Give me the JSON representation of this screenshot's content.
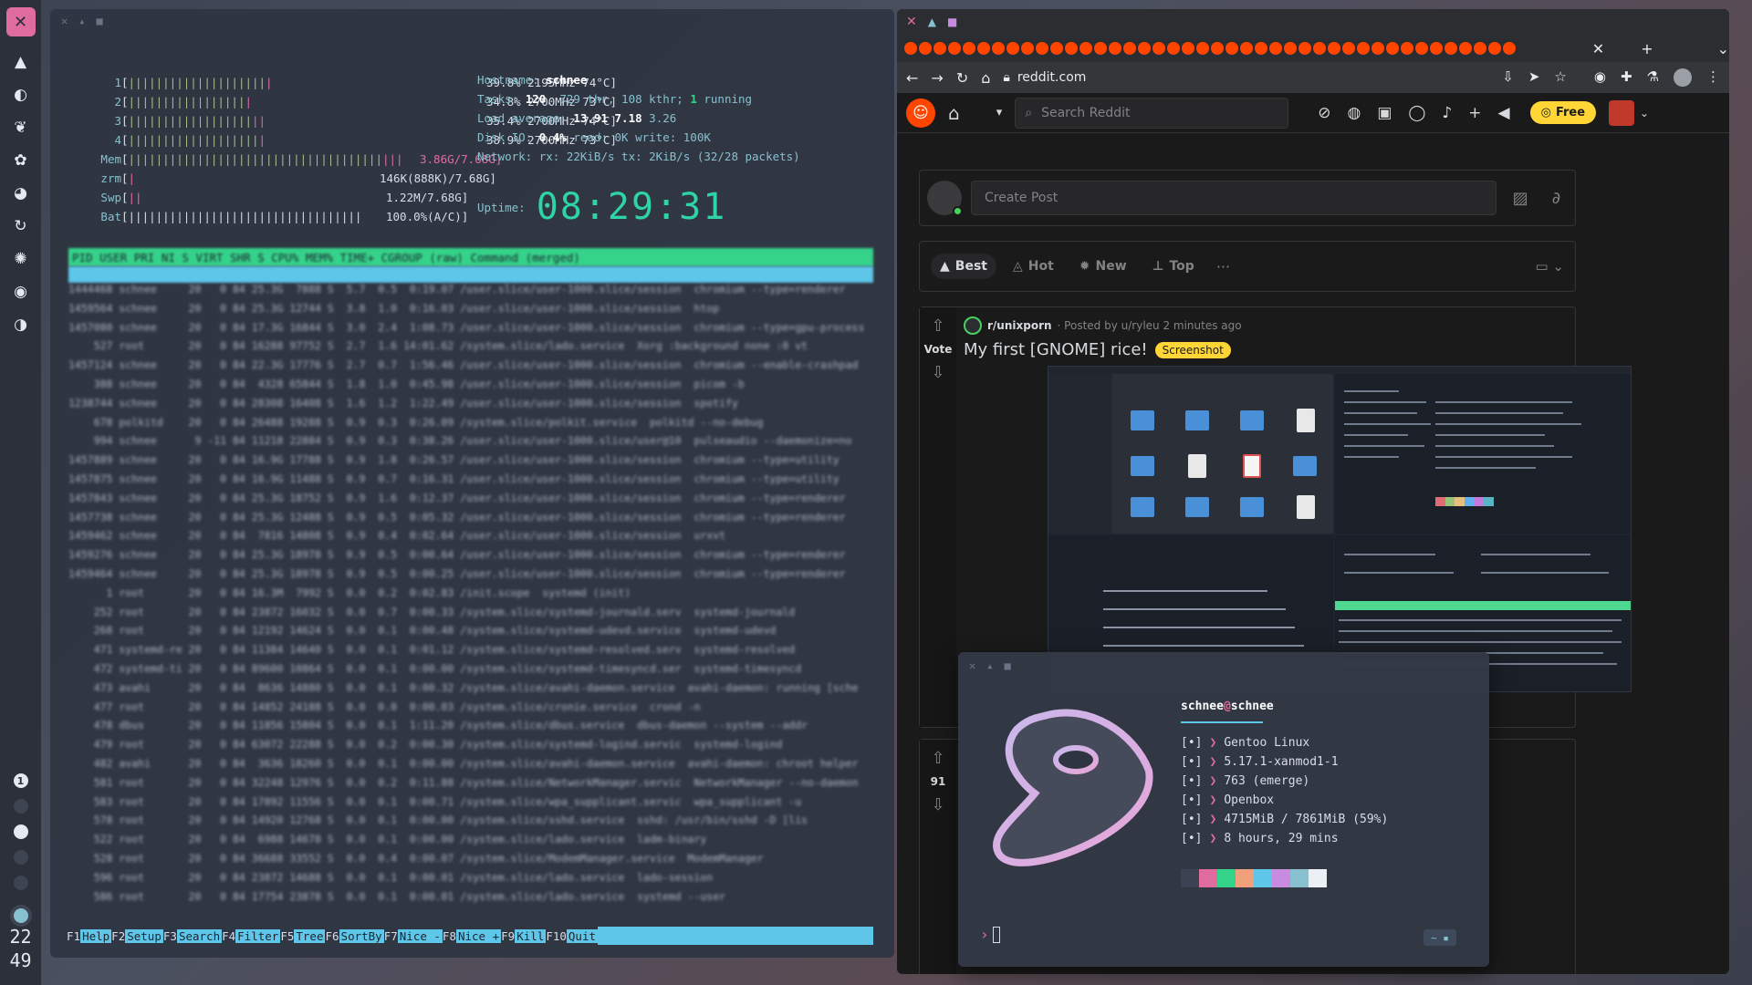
{
  "dock": {
    "icons": [
      "mountain-icon",
      "moon-icon",
      "leaf-icon",
      "lotus-icon",
      "palette-icon",
      "refresh-icon",
      "aperture-icon",
      "disc-icon",
      "audio-icon"
    ],
    "workspaces": [
      "1"
    ],
    "clock_hour": "22",
    "clock_min": "49"
  },
  "htop": {
    "cpus": [
      {
        "label": "1",
        "value": "39.8% 2195MHz 74°C]"
      },
      {
        "label": "2",
        "value": "34.8% 2700MHz 73°C]"
      },
      {
        "label": "3",
        "value": "35.4% 2700MHz 74°C]"
      },
      {
        "label": "4",
        "value": "38.9% 2700MHz 73°C]"
      }
    ],
    "mem": {
      "label": "Mem",
      "value": "3.86G/7.68G]"
    },
    "zrm": {
      "label": "zrm",
      "value": "146K(888K)/7.68G]"
    },
    "swp": {
      "label": "Swp",
      "value": "1.22M/7.68G]"
    },
    "bat": {
      "label": "Bat",
      "value": "100.0%(A/C)]"
    },
    "hostname_label": "Hostname: ",
    "hostname": "schnee",
    "tasks_label": "Tasks: ",
    "tasks": "120",
    "tasks_rest": ", 729 thr, 108 kthr; ",
    "running": "1",
    "running_label": " running",
    "load_label": "Load average: ",
    "load1": "13.91",
    "load5": "7.18",
    "load15": "3.26",
    "disk_label": "Disk IO: ",
    "disk_pct": "0.4%",
    "disk_rest": " read: 0K write: 100K",
    "net": "Network: rx: 22KiB/s tx: 2KiB/s (32/28 packets)",
    "uptime_label": "Uptime:",
    "uptime": "08:29:31",
    "header": "PID USER      PRI  NI S  VIRT  SHR S CPU% MEM%  TIME+  CGROUP (raw)                    Command (merged)",
    "rows": [
      "1444468 schnee     20   0 84 25.3G  7888 S  5.7  0.5  0:19.07 /user.slice/user-1000.slice/session  chromium --type=renderer",
      "1459564 schnee     20   0 84 25.3G 12744 S  3.8  1.0  0:16.03 /user.slice/user-1000.slice/session  htop",
      "1457080 schnee     20   0 84 17.3G 16844 S  3.0  2.4  1:08.73 /user.slice/user-1000.slice/session  chromium --type=gpu-process",
      "    527 root       20   0 84 16288 97752 S  2.7  1.6 14:01.62 /system.slice/lado.service  Xorg :background none :0 vt",
      "1457124 schnee     20   0 84 22.3G 17776 S  2.7  0.7  1:56.46 /user.slice/user-1000.slice/session  chromium --enable-crashpad",
      "    388 schnee     20   0 84  4328 65844 S  1.8  1.0  0:45.98 /user.slice/user-1000.slice/session  picom -b",
      "1238744 schnee     20   0 84 28308 16408 S  1.6  1.2  1:22.49 /user.slice/user-1000.slice/session  spotify",
      "    678 polkitd    20   0 84 26488 19288 S  0.9  0.3  0:26.09 /system.slice/polkit.service  polkitd --no-debug",
      "    994 schnee      9 -11 84 11218 22884 S  0.9  0.3  0:38.26 /user.slice/user-1000.slice/user@10  pulseaudio --daemonize=no",
      "1457889 schnee     20   0 84 16.9G 17788 S  0.9  1.8  0:26.57 /user.slice/user-1000.slice/session  chromium --type=utility",
      "1457875 schnee     20   0 84 16.9G 11488 S  0.9  0.7  0:16.31 /user.slice/user-1000.slice/session  chromium --type=utility",
      "1457843 schnee     20   0 84 25.3G 18752 S  0.9  1.6  0:12.37 /user.slice/user-1000.slice/session  chromium --type=renderer",
      "1457738 schnee     20   0 84 25.3G 12488 S  0.9  0.5  0:05.32 /user.slice/user-1000.slice/session  chromium --type=renderer",
      "1459462 schnee     20   0 84  7816 14808 S  0.9  0.4  0:02.64 /user.slice/user-1000.slice/session  urxvt",
      "1459276 schnee     20   0 84 25.3G 18978 S  0.9  0.5  0:00.64 /user.slice/user-1000.slice/session  chromium --type=renderer",
      "1459464 schnee     20   0 84 25.3G 18978 S  0.9  0.5  0:00.25 /user.slice/user-1000.slice/session  chromium --type=renderer",
      "      1 root       20   0 84 16.3M  7992 S  0.0  0.2  0:02.83 /init.scope  systemd (init)",
      "    252 root       20   0 84 23872 16032 S  0.0  0.7  0:00.33 /system.slice/systemd-journald.serv  systemd-journald",
      "    268 root       20   0 84 12192 14624 S  0.0  0.1  0:00.48 /system.slice/systemd-udevd.service  systemd-udevd",
      "    471 systemd-re 20   0 84 11384 14640 S  0.0  0.1  0:01.12 /system.slice/systemd-resolved.serv  systemd-resolved",
      "    472 systemd-ti 20   0 84 89600 10864 S  0.0  0.1  0:00.00 /system.slice/systemd-timesyncd.ser  systemd-timesyncd",
      "    473 avahi      20   0 84  8636 14880 S  0.0  0.1  0:00.32 /system.slice/avahi-daemon.service  avahi-daemon: running [sche",
      "    477 root       20   0 84 14852 24188 S  0.0  0.0  0:00.03 /system.slice/cronie.service  crond -n",
      "    478 dbus       20   0 84 11856 15804 S  0.0  0.1  1:11.20 /system.slice/dbus.service  dbus-daemon --system --addr",
      "    479 root       20   0 84 63072 22288 S  0.0  0.2  0:00.30 /system.slice/systemd-logind.servic  systemd-logind",
      "    482 avahi      20   0 84  3636 18260 S  0.0  0.1  0:00.00 /system.slice/avahi-daemon.service  avahi-daemon: chroot helper",
      "    581 root       20   0 84 32248 12976 S  0.0  0.2  0:11.88 /system.slice/NetworkManager.servic  NetworkManager --no-daemon",
      "    583 root       20   0 84 17892 11556 S  0.0  0.1  0:00.71 /system.slice/wpa_supplicant.servic  wpa_supplicant -u",
      "    578 root       20   0 84 14920 12768 S  0.0  0.1  0:00.00 /system.slice/sshd.service  sshd: /usr/bin/sshd -D [lis",
      "    522 root       20   0 84  6988 14678 S  0.0  0.1  0:00.00 /system.slice/lado.service  ladm-binary",
      "    528 root       20   0 84 36688 33552 S  0.0  0.4  0:00.07 /system.slice/ModemManager.service  ModemManager",
      "    596 root       20   0 84 23872 14688 S  0.0  0.1  0:00.01 /system.slice/lado.service  lado-session",
      "    586 root       20   0 84 17754 23878 S  0.0  0.1  0:00.01 /system.slice/lado.service  systemd --user"
    ],
    "fkeys": [
      {
        "key": "F1",
        "label": "Help  "
      },
      {
        "key": "F2",
        "label": "Setup "
      },
      {
        "key": "F3",
        "label": "Search"
      },
      {
        "key": "F4",
        "label": "Filter"
      },
      {
        "key": "F5",
        "label": "Tree  "
      },
      {
        "key": "F6",
        "label": "SortBy"
      },
      {
        "key": "F7",
        "label": "Nice -"
      },
      {
        "key": "F8",
        "label": "Nice +"
      },
      {
        "key": "F9",
        "label": "Kill  "
      },
      {
        "key": "F10",
        "label": "Quit"
      }
    ]
  },
  "browser": {
    "url": "reddit.com",
    "tab_count": 42,
    "search_placeholder": "Search Reddit",
    "free_label": "Free",
    "create_post_placeholder": "Create Post",
    "sort": {
      "best": "Best",
      "hot": "Hot",
      "new": "New",
      "top": "Top",
      "more": "···"
    },
    "post": {
      "vote_label": "Vote",
      "subreddit": "r/unixporn",
      "meta": "· Posted by u/ryleu 2 minutes ago",
      "title": "My first [GNOME] rice!",
      "flair": "Screenshot"
    },
    "post2": {
      "votes": "91"
    }
  },
  "neofetch": {
    "user": "schnee",
    "at": "@",
    "host": "schnee",
    "lines": [
      {
        "icon": "[•]",
        "text": "Gentoo Linux"
      },
      {
        "icon": "[•]",
        "text": "5.17.1-xanmod1-1"
      },
      {
        "icon": "[•]",
        "text": "763 (emerge)"
      },
      {
        "icon": "[•]",
        "text": "Openbox"
      },
      {
        "icon": "[•]",
        "text": "4715MiB / 7861MiB (59%)"
      },
      {
        "icon": "[•]",
        "text": "8 hours, 29 mins"
      }
    ],
    "swatches": [
      "#3b4252",
      "#e06c9f",
      "#35d38a",
      "#f0a07a",
      "#5ec6e8",
      "#c98be0",
      "#88c0d0",
      "#eceff4"
    ],
    "prompt": "›"
  },
  "colors": {
    "accent_cyan": "#5ec6e8",
    "accent_pink": "#e06c9f",
    "htop_header_green": "#35d38a",
    "reddit_orange": "#ff4500"
  }
}
